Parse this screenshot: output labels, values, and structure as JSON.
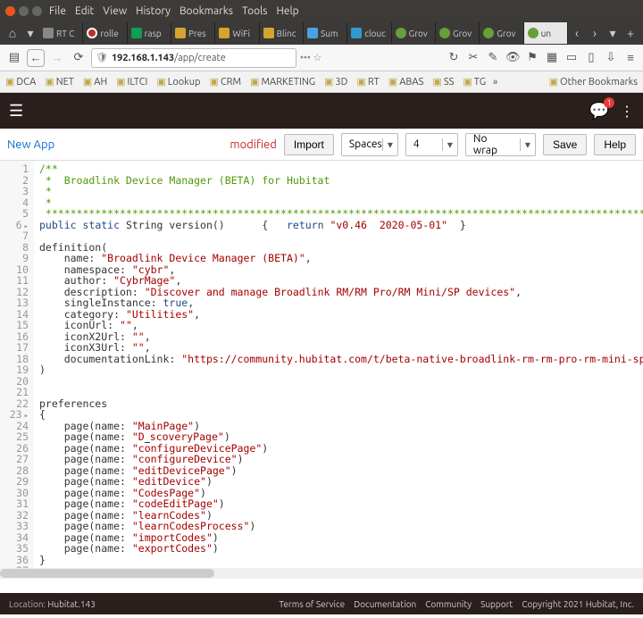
{
  "menubar": [
    "File",
    "Edit",
    "View",
    "History",
    "Bookmarks",
    "Tools",
    "Help"
  ],
  "tabs": [
    {
      "label": "RT C",
      "fv": "fv-rt"
    },
    {
      "label": "rolle",
      "fv": "fv-ro"
    },
    {
      "label": "rasp",
      "fv": "fv-g"
    },
    {
      "label": "Pres",
      "fv": "fv-w"
    },
    {
      "label": "WiFi",
      "fv": "fv-w"
    },
    {
      "label": "Blinc",
      "fv": "fv-w"
    },
    {
      "label": "Sum",
      "fv": "fv-sum"
    },
    {
      "label": "clouc",
      "fv": "fv-cld"
    },
    {
      "label": "Grov",
      "fv": "fv-grv"
    },
    {
      "label": "Grov",
      "fv": "fv-grv"
    },
    {
      "label": "Grov",
      "fv": "fv-grv"
    },
    {
      "label": "un",
      "fv": "fv-grv",
      "active": true
    }
  ],
  "url": {
    "host": "192.168.1.143",
    "path": "/app/create"
  },
  "bookmarks": [
    "DCA",
    "NET",
    "AH",
    "ILTCI",
    "Lookup",
    "CRM",
    "MARKETING",
    "3D",
    "RT",
    "ABAS",
    "SS",
    "TG"
  ],
  "other_bookmarks": "Other Bookmarks",
  "apphdr": {
    "badge": "1"
  },
  "toolbar": {
    "newapp": "New App",
    "modified": "modified",
    "import": "Import",
    "tab_mode": "Spaces",
    "indent": "4",
    "wrap": "No wrap",
    "save": "Save",
    "help": "Help"
  },
  "code": {
    "lines": [
      {
        "n": 1,
        "seg": [
          [
            "/**",
            "c-cmt"
          ]
        ]
      },
      {
        "n": 2,
        "seg": [
          [
            " *  Broadlink Device Manager (BETA) for Hubitat",
            "c-cmt"
          ]
        ]
      },
      {
        "n": 3,
        "seg": [
          [
            " *",
            "c-cmt"
          ]
        ]
      },
      {
        "n": 4,
        "seg": [
          [
            " *",
            "c-cmt"
          ]
        ]
      },
      {
        "n": 5,
        "seg": [
          [
            " ****************************************************************************************************************************",
            "c-cmt"
          ]
        ]
      },
      {
        "n": 6,
        "fold": true,
        "seg": [
          [
            "public ",
            "c-kw"
          ],
          [
            "static ",
            "c-kw"
          ],
          [
            "String",
            ""
          ],
          [
            " version()      {   ",
            ""
          ],
          [
            "return ",
            "c-kw"
          ],
          [
            "\"v0.46  2020-05-01\"",
            "c-str"
          ],
          [
            "  }",
            ""
          ]
        ]
      },
      {
        "n": 7,
        "seg": [
          [
            "",
            ""
          ]
        ]
      },
      {
        "n": 8,
        "seg": [
          [
            "definition(",
            ""
          ]
        ]
      },
      {
        "n": 9,
        "seg": [
          [
            "    name: ",
            ""
          ],
          [
            "\"Broadlink Device Manager (BETA)\"",
            "c-str"
          ],
          [
            ",",
            ""
          ]
        ]
      },
      {
        "n": 10,
        "seg": [
          [
            "    namespace: ",
            ""
          ],
          [
            "\"cybr\"",
            "c-str"
          ],
          [
            ",",
            ""
          ]
        ]
      },
      {
        "n": 11,
        "seg": [
          [
            "    author: ",
            ""
          ],
          [
            "\"CybrMage\"",
            "c-str"
          ],
          [
            ",",
            ""
          ]
        ]
      },
      {
        "n": 12,
        "seg": [
          [
            "    description: ",
            ""
          ],
          [
            "\"Discover and manage Broadlink RM/RM Pro/RM Mini/SP devices\"",
            "c-str"
          ],
          [
            ",",
            ""
          ]
        ]
      },
      {
        "n": 13,
        "seg": [
          [
            "    singleInstance: ",
            ""
          ],
          [
            "true",
            "c-kw"
          ],
          [
            ",",
            ""
          ]
        ]
      },
      {
        "n": 14,
        "seg": [
          [
            "    category: ",
            ""
          ],
          [
            "\"Utilities\"",
            "c-str"
          ],
          [
            ",",
            ""
          ]
        ]
      },
      {
        "n": 15,
        "seg": [
          [
            "    iconUrl: ",
            ""
          ],
          [
            "\"\"",
            "c-str"
          ],
          [
            ",",
            ""
          ]
        ]
      },
      {
        "n": 16,
        "seg": [
          [
            "    iconX2Url: ",
            ""
          ],
          [
            "\"\"",
            "c-str"
          ],
          [
            ",",
            ""
          ]
        ]
      },
      {
        "n": 17,
        "seg": [
          [
            "    iconX3Url: ",
            ""
          ],
          [
            "\"\"",
            "c-str"
          ],
          [
            ",",
            ""
          ]
        ]
      },
      {
        "n": 18,
        "seg": [
          [
            "    documentationLink: ",
            ""
          ],
          [
            "\"https://community.hubitat.com/t/beta-native-broadlink-rm-rm-pro-rm-mini-sp-driver-rc-hvac",
            "c-str"
          ]
        ]
      },
      {
        "n": 19,
        "seg": [
          [
            ")",
            ""
          ]
        ]
      },
      {
        "n": 20,
        "seg": [
          [
            "",
            ""
          ]
        ]
      },
      {
        "n": 21,
        "seg": [
          [
            "",
            ""
          ]
        ]
      },
      {
        "n": 22,
        "seg": [
          [
            "preferences",
            ""
          ]
        ]
      },
      {
        "n": 23,
        "fold": true,
        "seg": [
          [
            "{",
            ""
          ]
        ]
      },
      {
        "n": 24,
        "seg": [
          [
            "    page(name: ",
            ""
          ],
          [
            "\"MainPage\"",
            "c-str"
          ],
          [
            ")",
            ""
          ]
        ]
      },
      {
        "n": 25,
        "seg": [
          [
            "    page(name: ",
            ""
          ],
          [
            "\"D",
            "c-str"
          ]
        ],
        "cursor": true,
        "tail": [
          [
            "scoveryPage\"",
            "c-str"
          ],
          [
            ")",
            ""
          ]
        ]
      },
      {
        "n": 26,
        "seg": [
          [
            "    page(name: ",
            ""
          ],
          [
            "\"configureDevicePage\"",
            "c-str"
          ],
          [
            ")",
            ""
          ]
        ]
      },
      {
        "n": 27,
        "seg": [
          [
            "    page(name: ",
            ""
          ],
          [
            "\"configureDevice\"",
            "c-str"
          ],
          [
            ")",
            ""
          ]
        ]
      },
      {
        "n": 28,
        "seg": [
          [
            "    page(name: ",
            ""
          ],
          [
            "\"editDevicePage\"",
            "c-str"
          ],
          [
            ")",
            ""
          ]
        ]
      },
      {
        "n": 29,
        "seg": [
          [
            "    page(name: ",
            ""
          ],
          [
            "\"editDevice\"",
            "c-str"
          ],
          [
            ")",
            ""
          ]
        ]
      },
      {
        "n": 30,
        "seg": [
          [
            "    page(name: ",
            ""
          ],
          [
            "\"CodesPage\"",
            "c-str"
          ],
          [
            ")",
            ""
          ]
        ]
      },
      {
        "n": 31,
        "seg": [
          [
            "    page(name: ",
            ""
          ],
          [
            "\"codeEditPage\"",
            "c-str"
          ],
          [
            ")",
            ""
          ]
        ]
      },
      {
        "n": 32,
        "seg": [
          [
            "    page(name: ",
            ""
          ],
          [
            "\"learnCodes\"",
            "c-str"
          ],
          [
            ")",
            ""
          ]
        ]
      },
      {
        "n": 33,
        "seg": [
          [
            "    page(name: ",
            ""
          ],
          [
            "\"learnCodesProcess\"",
            "c-str"
          ],
          [
            ")",
            ""
          ]
        ]
      },
      {
        "n": 34,
        "seg": [
          [
            "    page(name: ",
            ""
          ],
          [
            "\"importCodes\"",
            "c-str"
          ],
          [
            ")",
            ""
          ]
        ]
      },
      {
        "n": 35,
        "seg": [
          [
            "    page(name: ",
            ""
          ],
          [
            "\"exportCodes\"",
            "c-str"
          ],
          [
            ")",
            ""
          ]
        ]
      },
      {
        "n": 36,
        "seg": [
          [
            "}",
            ""
          ]
        ]
      },
      {
        "n": 37,
        "seg": [
          [
            "",
            ""
          ]
        ]
      }
    ]
  },
  "footer": {
    "loc_label": "Location:",
    "loc_value": "Hubitat.143",
    "links": [
      "Terms of Service",
      "Documentation",
      "Community",
      "Support"
    ],
    "copyright": "Copyright 2021 Hubitat, Inc."
  }
}
